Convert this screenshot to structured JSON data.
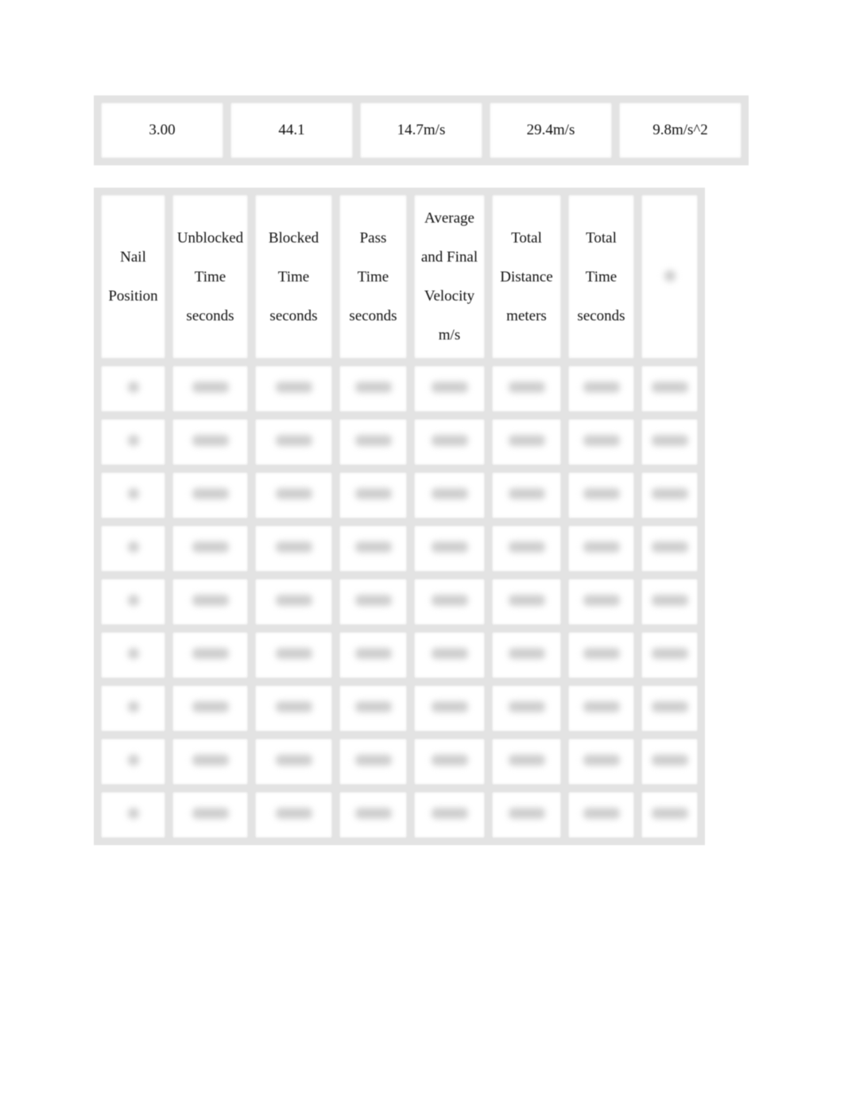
{
  "summary_table": {
    "cells": [
      "3.00",
      "44.1",
      "14.7m/s",
      "29.4m/s",
      "9.8m/s^2"
    ]
  },
  "data_table": {
    "headers": [
      [
        "Nail",
        "Position"
      ],
      [
        "Unblocked",
        "Time",
        "seconds"
      ],
      [
        "Blocked",
        "Time",
        "seconds"
      ],
      [
        "Pass",
        "Time",
        "seconds"
      ],
      [
        "Average",
        "and Final",
        "Velocity",
        "m/s"
      ],
      [
        "Total",
        "Distance",
        "meters"
      ],
      [
        "Total",
        "Time",
        "seconds"
      ],
      []
    ],
    "row_count_note": ""
  }
}
